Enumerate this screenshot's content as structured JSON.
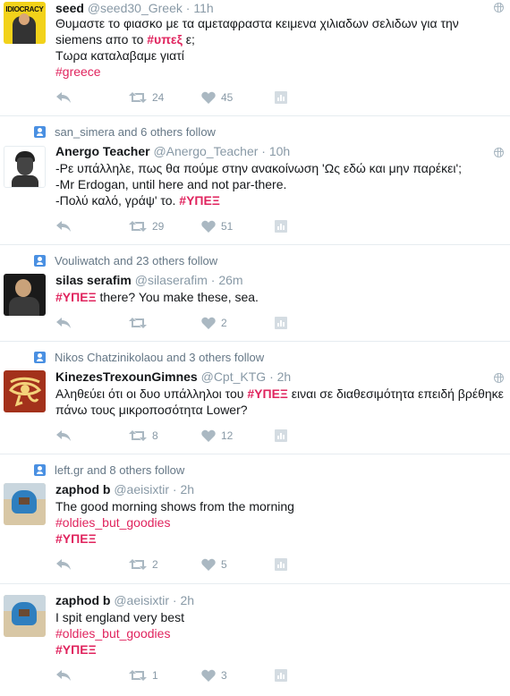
{
  "colors": {
    "hashtag": "#e0245e",
    "icon": "#aab8c2",
    "meta": "#8899a6",
    "context": "#657786",
    "follow_badge": "#4a90e2"
  },
  "tweets": [
    {
      "name": "seed",
      "handle": "@seed30_Greek",
      "sep": "·",
      "time": "11h",
      "avatar_text": "IDIOCRACY",
      "lines": [
        "Θυμαστε το φιασκο με τα αμεταφραστα κειμενα χιλιαδων σελιδων για την",
        "siemens απο το ",
        "#υπεξ",
        " ε;",
        "Τωρα καταλαβαμε γιατί",
        "#greece"
      ],
      "retweets": "24",
      "likes": "45"
    },
    {
      "context": "san_simera and 6 others follow",
      "name": "Anergo Teacher",
      "handle": "@Anergo_Teacher",
      "sep": "·",
      "time": "10h",
      "lines": [
        "-Ρε υπάλληλε, πως θα πούμε στην ανακοίνωση 'Ως εδώ και μην παρέκει';",
        "-Mr Erdogan, until here and not par-there.",
        "-Πολύ καλό, γράψ' το. ",
        "#ΥΠΕΞ"
      ],
      "retweets": "29",
      "likes": "51"
    },
    {
      "context": "Vouliwatch and 23 others follow",
      "name": "silas serafim",
      "handle": "@silaserafim",
      "sep": "·",
      "time": "26m",
      "lines": [
        "#ΥΠΕΞ",
        " there? You make these, sea."
      ],
      "retweets": "",
      "likes": "2"
    },
    {
      "context": "Nikos Chatzinikolaou and 3 others follow",
      "name": "KinezesTrexounGimnes",
      "handle": "@Cpt_KTG",
      "sep": "·",
      "time": "2h",
      "lines": [
        "Αληθεύει ότι οι δυο υπάλληλοι του ",
        "#ΥΠΕΞ",
        " ειναι σε διαθεσιμότητα επειδή βρέθηκε",
        "πάνω τους μικροποσότητα Lower?"
      ],
      "retweets": "8",
      "likes": "12"
    },
    {
      "context": "left.gr and 8 others follow",
      "name": "zaphod b",
      "handle": "@aeisixtir",
      "sep": "·",
      "time": "2h",
      "lines": [
        "The good morning shows from the morning",
        "#oldies_but_goodies",
        "#ΥΠΕΞ"
      ],
      "retweets": "2",
      "likes": "5"
    },
    {
      "name": "zaphod b",
      "handle": "@aeisixtir",
      "sep": "·",
      "time": "2h",
      "lines": [
        "I spit england very best",
        "#oldies_but_goodies",
        "#ΥΠΕΞ"
      ],
      "retweets": "1",
      "likes": "3"
    }
  ]
}
